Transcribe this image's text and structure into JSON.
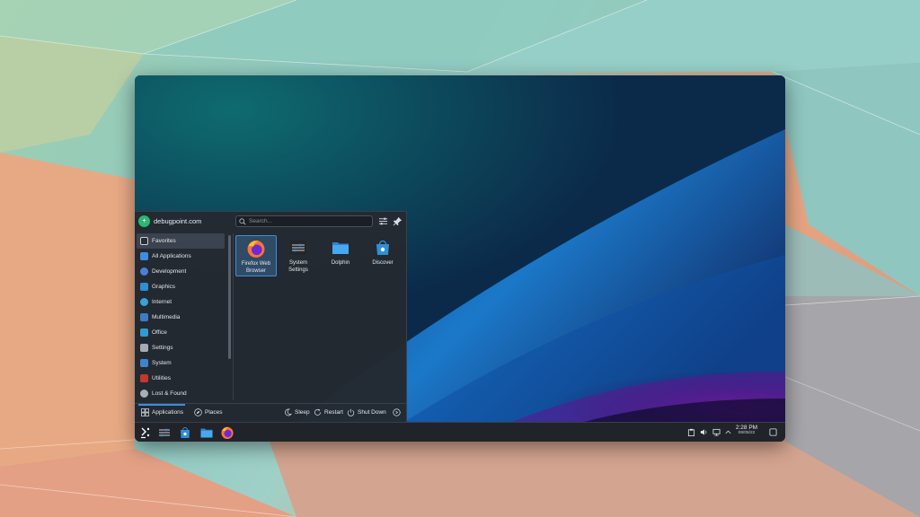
{
  "menu": {
    "user": {
      "initial": "+",
      "name": "debugpoint.com"
    },
    "search": {
      "placeholder": "Search..."
    },
    "categories": [
      {
        "label": "Favorites",
        "icon": "bookmark-icon",
        "color": "#2a2e34"
      },
      {
        "label": "All Applications",
        "icon": "grid-icon",
        "color": "#3d8ee0"
      },
      {
        "label": "Development",
        "icon": "development-icon",
        "color": "#4a7fd6"
      },
      {
        "label": "Graphics",
        "icon": "graphics-icon",
        "color": "#2d8fd6"
      },
      {
        "label": "Internet",
        "icon": "globe-icon",
        "color": "#36a2d8"
      },
      {
        "label": "Multimedia",
        "icon": "multimedia-icon",
        "color": "#3c7cc4"
      },
      {
        "label": "Office",
        "icon": "office-icon",
        "color": "#2f9bd1"
      },
      {
        "label": "Settings",
        "icon": "settings-icon",
        "color": "#a5abb3"
      },
      {
        "label": "System",
        "icon": "system-icon",
        "color": "#3f83c9"
      },
      {
        "label": "Utilities",
        "icon": "utilities-icon",
        "color": "#c0392b"
      },
      {
        "label": "Lost & Found",
        "icon": "lost-found-icon",
        "color": "#a9aeb5"
      }
    ],
    "apps": [
      {
        "line1": "Firefox Web",
        "line2": "Browser",
        "icon": "firefox-icon"
      },
      {
        "line1": "System",
        "line2": "Settings",
        "icon": "system-settings-icon"
      },
      {
        "line1": "Dolphin",
        "line2": "",
        "icon": "dolphin-folder-icon"
      },
      {
        "line1": "Discover",
        "line2": "",
        "icon": "discover-icon"
      }
    ],
    "footer": {
      "applications": "Applications",
      "places": "Places",
      "sleep": "Sleep",
      "restart": "Restart",
      "shutdown": "Shut Down"
    }
  },
  "taskbar": {
    "clock_time": "2:28 PM",
    "clock_date": "08/05/22"
  },
  "colors": {
    "accent": "#3d8ee0",
    "panel": "#242931",
    "taskbar": "#20242a"
  }
}
